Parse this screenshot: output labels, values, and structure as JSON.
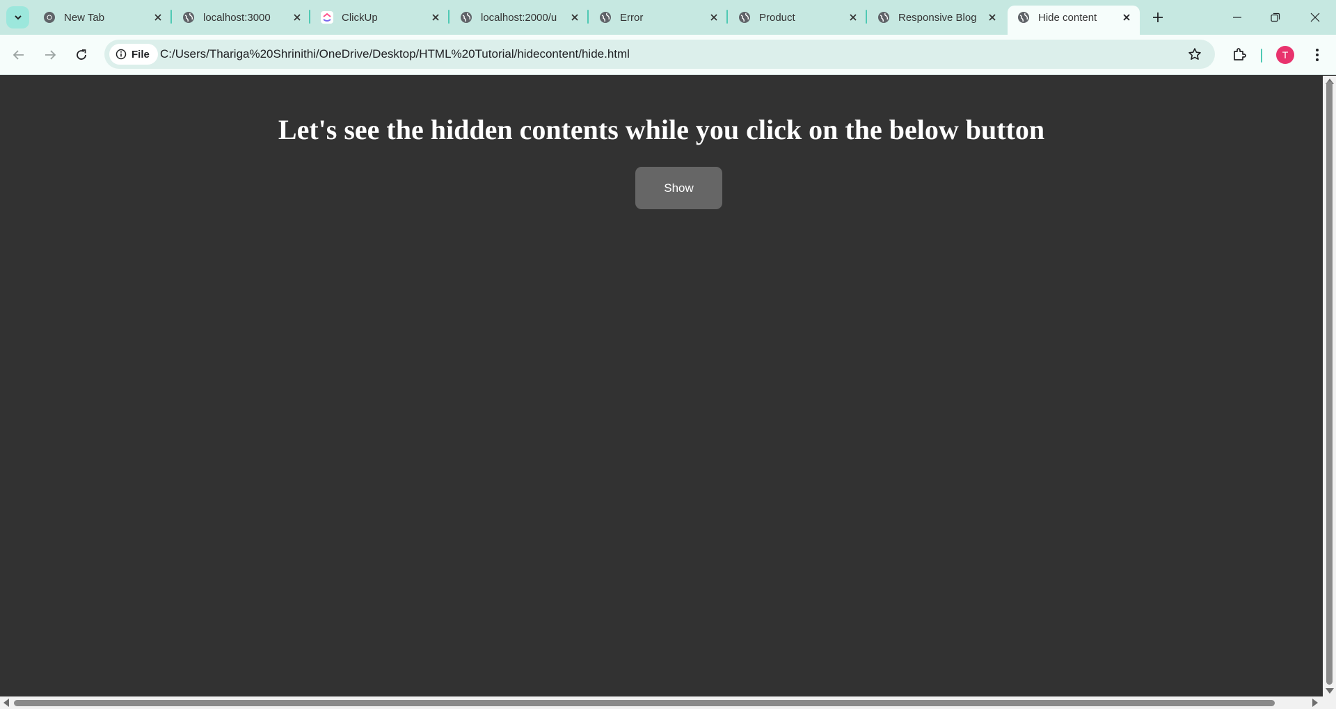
{
  "browser": {
    "tabs": [
      {
        "title": "New Tab",
        "icon": "chrome-icon"
      },
      {
        "title": "localhost:3000",
        "icon": "globe-icon"
      },
      {
        "title": "ClickUp",
        "icon": "clickup-icon"
      },
      {
        "title": "localhost:2000/u",
        "icon": "globe-icon"
      },
      {
        "title": "Error",
        "icon": "globe-icon"
      },
      {
        "title": "Product",
        "icon": "globe-icon"
      },
      {
        "title": "Responsive Blog",
        "icon": "globe-icon"
      },
      {
        "title": "Hide content",
        "icon": "globe-icon",
        "active": true
      }
    ],
    "omnibox": {
      "chip_label": "File",
      "url": "C:/Users/Thariga%20Shrinithi/OneDrive/Desktop/HTML%20Tutorial/hidecontent/hide.html"
    },
    "profile_initial": "T",
    "accent_color": "#4fc9b4",
    "profile_color": "#e8336d"
  },
  "page": {
    "heading": "Let's see the hidden contents while you click on the below button",
    "button_label": "Show",
    "background_color": "#323232",
    "button_color": "#666666"
  }
}
